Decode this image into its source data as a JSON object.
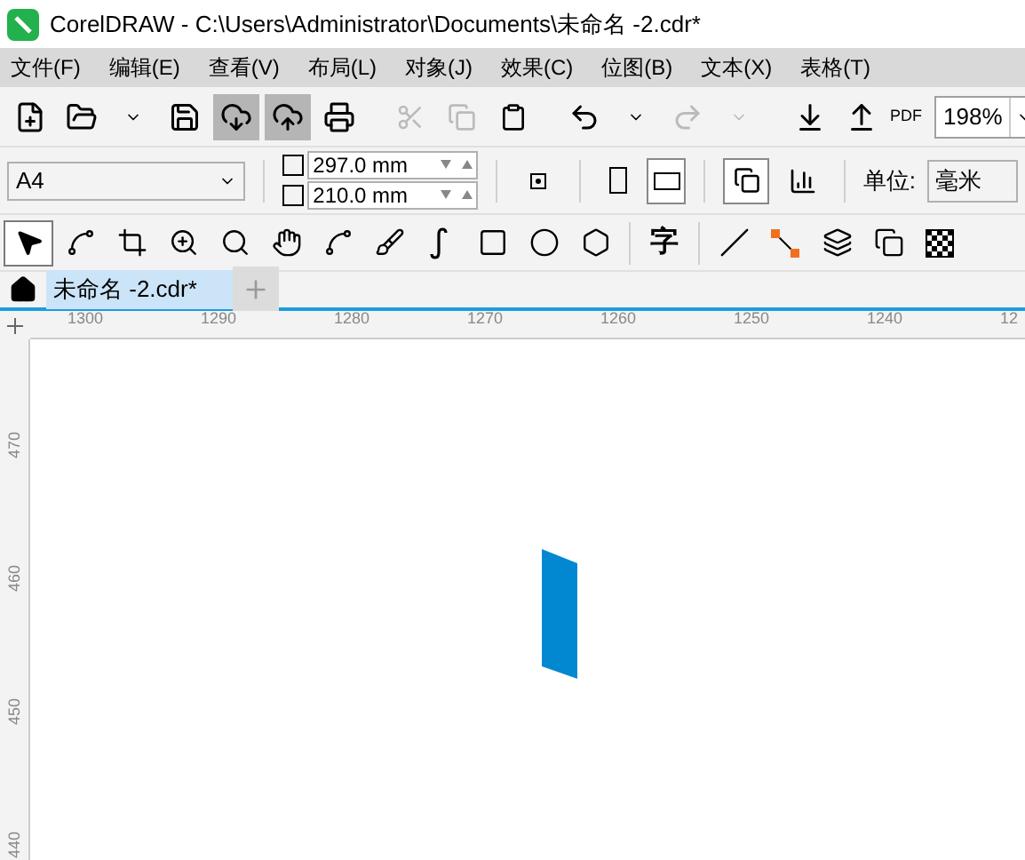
{
  "window": {
    "title": "CorelDRAW - C:\\Users\\Administrator\\Documents\\未命名 -2.cdr*"
  },
  "menu": [
    "文件(F)",
    "编辑(E)",
    "查看(V)",
    "布局(L)",
    "对象(J)",
    "效果(C)",
    "位图(B)",
    "文本(X)",
    "表格(T)"
  ],
  "toolbar": {
    "zoom": "198%",
    "pdf_label": "PDF"
  },
  "property_bar": {
    "page_size": "A4",
    "width": "297.0 mm",
    "height": "210.0 mm",
    "units_label": "单位:",
    "units": "毫米",
    "landscape": true
  },
  "toolbox": [
    {
      "kind": "pointer",
      "selected": true
    },
    {
      "kind": "shape",
      "selected": false
    },
    {
      "kind": "crop",
      "selected": false
    },
    {
      "kind": "zoom",
      "selected": false
    },
    {
      "kind": "zoom2",
      "selected": false
    },
    {
      "kind": "pan",
      "selected": false
    },
    {
      "kind": "curve",
      "selected": false
    },
    {
      "kind": "brush",
      "selected": false
    },
    {
      "kind": "smart",
      "selected": false
    },
    {
      "kind": "rect",
      "selected": false
    },
    {
      "kind": "ellipse",
      "selected": false
    },
    {
      "kind": "polygon",
      "selected": false
    },
    {
      "kind": "text",
      "label": "字",
      "selected": false
    },
    {
      "kind": "line",
      "selected": false
    },
    {
      "kind": "connector",
      "selected": false
    },
    {
      "kind": "blend",
      "selected": false
    },
    {
      "kind": "shadow",
      "selected": false
    },
    {
      "kind": "transparency",
      "selected": false
    }
  ],
  "tabs": [
    {
      "label": "未命名 -2.cdr*",
      "selected": true
    }
  ],
  "ruler_h": [
    "1300",
    "1290",
    "1280",
    "1270",
    "1260",
    "1250",
    "1240",
    "12"
  ],
  "ruler_v": [
    "470",
    "460",
    "450",
    "440"
  ]
}
